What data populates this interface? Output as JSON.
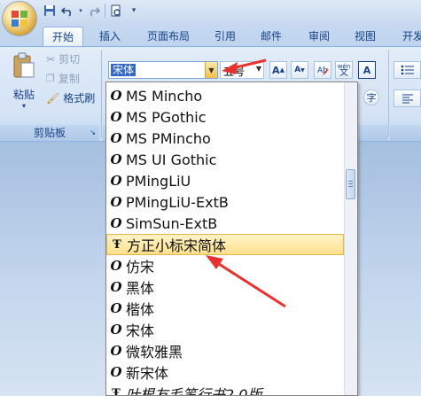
{
  "qat": {
    "icons": [
      "save-icon",
      "undo-icon",
      "redo-icon",
      "print-preview-icon",
      "customize-icon"
    ]
  },
  "tabs": [
    {
      "label": "开始",
      "active": true
    },
    {
      "label": "插入"
    },
    {
      "label": "页面布局"
    },
    {
      "label": "引用"
    },
    {
      "label": "邮件"
    },
    {
      "label": "审阅"
    },
    {
      "label": "视图"
    },
    {
      "label": "开发"
    }
  ],
  "clipboard": {
    "paste_label": "粘贴",
    "cut_label": "剪切",
    "copy_label": "复制",
    "format_painter_label": "格式刷",
    "group_caption": "剪贴板"
  },
  "font_group": {
    "font_name": "宋体",
    "font_size": "五号",
    "grow_label": "A",
    "shrink_label": "A",
    "phonetic_label": "wén",
    "clear_label": "A"
  },
  "font_list": [
    {
      "name": "MS Mincho",
      "type": "opentype"
    },
    {
      "name": "MS PGothic",
      "type": "opentype"
    },
    {
      "name": "MS PMincho",
      "type": "opentype"
    },
    {
      "name": "MS UI Gothic",
      "type": "opentype"
    },
    {
      "name": "PMingLiU",
      "type": "opentype"
    },
    {
      "name": "PMingLiU-ExtB",
      "type": "opentype"
    },
    {
      "name": "SimSun-ExtB",
      "type": "opentype"
    },
    {
      "name": "方正小标宋简体",
      "type": "truetype",
      "selected": true
    },
    {
      "name": "仿宋",
      "type": "opentype"
    },
    {
      "name": "黑体",
      "type": "opentype"
    },
    {
      "name": "楷体",
      "type": "opentype"
    },
    {
      "name": "宋体",
      "type": "opentype"
    },
    {
      "name": "微软雅黑",
      "type": "opentype"
    },
    {
      "name": "新宋体",
      "type": "opentype"
    },
    {
      "name": "叶根友毛笔行书2.0版",
      "type": "truetype"
    }
  ],
  "colors": {
    "accent": "#15428b",
    "highlight": "#fde08c",
    "arrow": "#e8322f"
  }
}
